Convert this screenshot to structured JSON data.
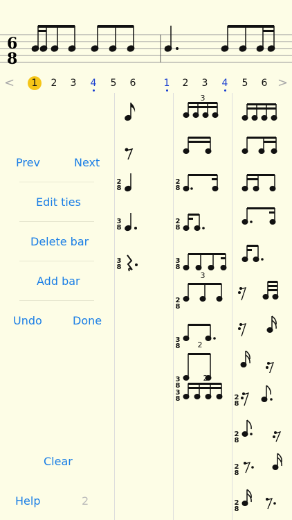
{
  "staff": {
    "time_signature_top": "6",
    "time_signature_bottom": "8"
  },
  "beat_row": {
    "prev_arrow": "<",
    "next_arrow": ">",
    "beats": [
      "1",
      "2",
      "3",
      "4",
      "5",
      "6",
      "1",
      "2",
      "3",
      "4",
      "5",
      "6"
    ]
  },
  "sidebar": {
    "prev": "Prev",
    "next": "Next",
    "edit_ties": "Edit ties",
    "delete_bar": "Delete bar",
    "add_bar": "Add bar",
    "undo": "Undo",
    "done": "Done",
    "clear": "Clear",
    "help": "Help",
    "count": "2"
  },
  "palette": {
    "tuplet_3": "3",
    "tuplet_2": "2",
    "ts_2_top": "2",
    "ts_2_bottom": "8",
    "ts_3_top": "3",
    "ts_3_bottom": "8"
  },
  "colors": {
    "background": "#fdfde6",
    "accent": "#1a7ee6",
    "selected": "#f5c518",
    "beat_blue": "#1a3fd0"
  }
}
